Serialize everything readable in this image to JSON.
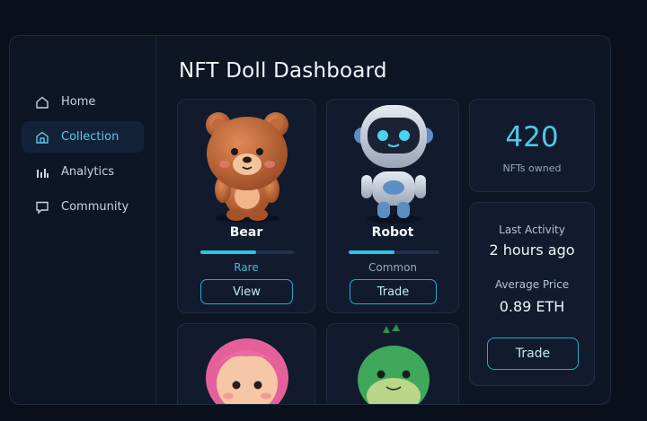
{
  "title": "NFT Doll Dashboard",
  "sidebar": {
    "items": [
      {
        "label": "Home",
        "icon": "home-icon",
        "active": false
      },
      {
        "label": "Collection",
        "icon": "collection-icon",
        "active": true
      },
      {
        "label": "Analytics",
        "icon": "analytics-icon",
        "active": false
      },
      {
        "label": "Community",
        "icon": "chat-icon",
        "active": false
      }
    ]
  },
  "cards": [
    {
      "name": "Bear",
      "rarity": "Rare",
      "action": "View",
      "progress": 0.6
    },
    {
      "name": "Robot",
      "rarity": "Common",
      "action": "Trade",
      "progress": 0.5
    }
  ],
  "stats": {
    "count": "420",
    "count_label": "NFTs owned"
  },
  "activity": {
    "last_label": "Last Activity",
    "last_value": "2 hours ago",
    "price_label": "Average Price",
    "price_value": "0.89 ETH",
    "trade_label": "Trade"
  },
  "colors": {
    "accent": "#2ec4e6",
    "panel": "#111b2d",
    "background": "#0a0f1c"
  }
}
